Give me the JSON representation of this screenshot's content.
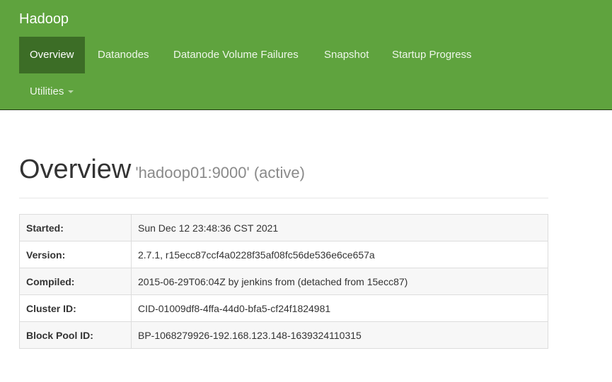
{
  "navbar": {
    "brand": "Hadoop",
    "items": [
      {
        "label": "Overview",
        "active": true
      },
      {
        "label": "Datanodes",
        "active": false
      },
      {
        "label": "Datanode Volume Failures",
        "active": false
      },
      {
        "label": "Snapshot",
        "active": false
      },
      {
        "label": "Startup Progress",
        "active": false
      },
      {
        "label": "Utilities",
        "active": false,
        "dropdown": true
      }
    ],
    "color": "#5fa33e",
    "active_color": "#3c6d26"
  },
  "header": {
    "title": "Overview",
    "subtitle": "'hadoop01:9000' (active)"
  },
  "info_table": [
    {
      "key": "Started:",
      "value": "Sun Dec 12 23:48:36 CST 2021"
    },
    {
      "key": "Version:",
      "value": "2.7.1, r15ecc87ccf4a0228f35af08fc56de536e6ce657a"
    },
    {
      "key": "Compiled:",
      "value": "2015-06-29T06:04Z by jenkins from (detached from 15ecc87)"
    },
    {
      "key": "Cluster ID:",
      "value": "CID-01009df8-4ffa-44d0-bfa5-cf24f1824981"
    },
    {
      "key": "Block Pool ID:",
      "value": "BP-1068279926-192.168.123.148-1639324110315"
    }
  ]
}
